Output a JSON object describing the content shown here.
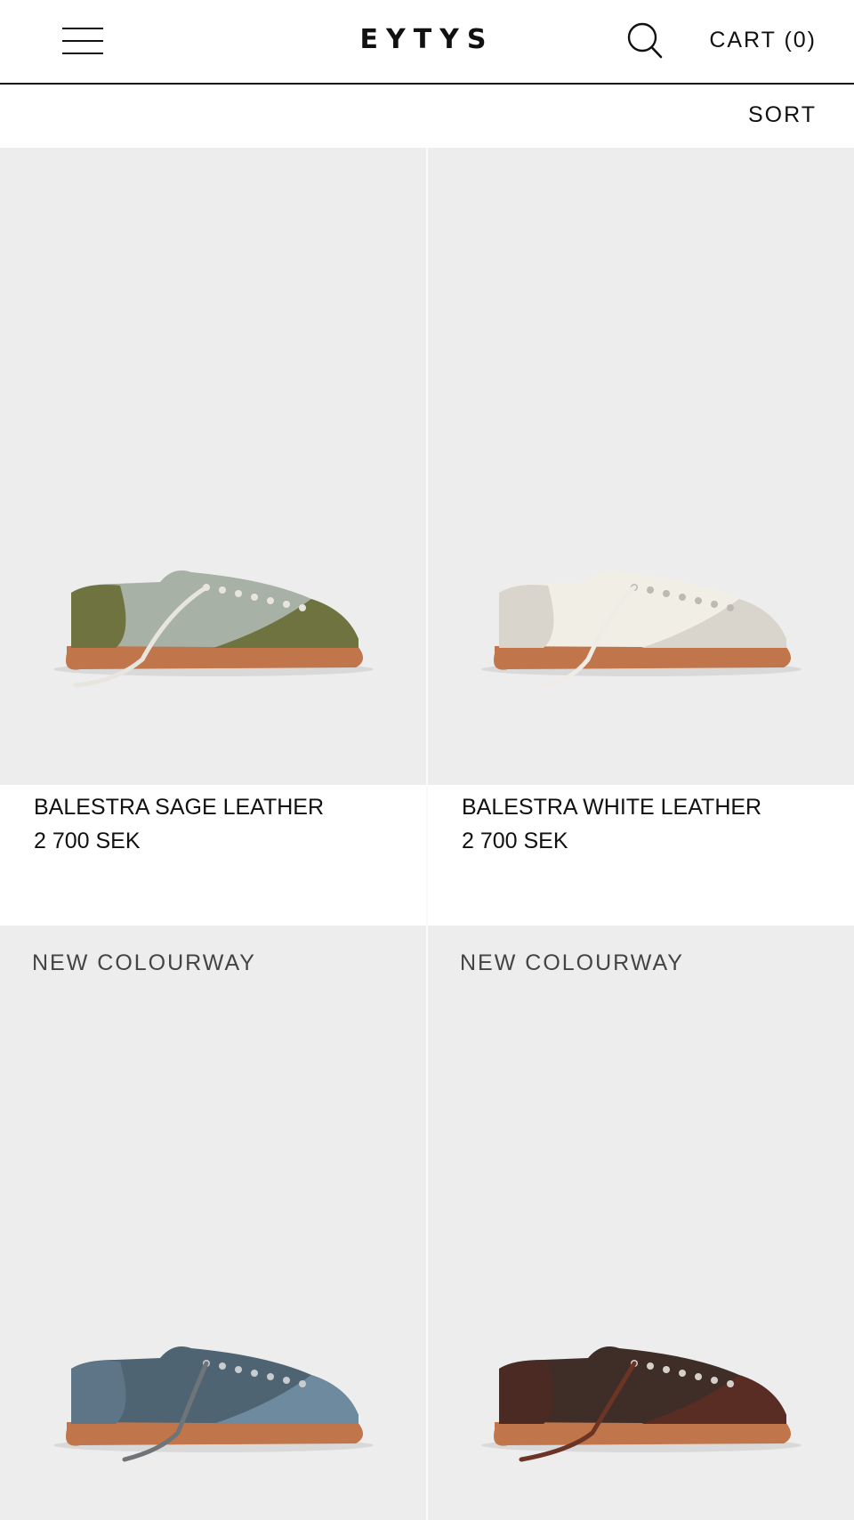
{
  "header": {
    "logo": "EYTYS",
    "cart_label": "CART",
    "cart_count": "(0)",
    "icons": {
      "menu": "hamburger-icon",
      "search": "search-icon"
    }
  },
  "toolbar": {
    "sort_label": "SORT"
  },
  "products": [
    {
      "name": "BALESTRA SAGE LEATHER",
      "price": "2 700 SEK",
      "badge": "",
      "colors": {
        "upper": "#a7b1a6",
        "suede": "#6f7340",
        "sole": "#c0764a",
        "lace": "#e8e5df"
      }
    },
    {
      "name": "BALESTRA WHITE LEATHER",
      "price": "2 700 SEK",
      "badge": "",
      "colors": {
        "upper": "#f1eee6",
        "suede": "#d9d5cd",
        "sole": "#c0764a",
        "lace": "#efece5"
      }
    },
    {
      "name": "",
      "price": "",
      "badge": "NEW COLOURWAY",
      "colors": {
        "upper": "#4f6473",
        "suede": "#6d8a9f",
        "sole": "#c0764a",
        "lace": "#6f7478"
      }
    },
    {
      "name": "",
      "price": "",
      "badge": "NEW COLOURWAY",
      "colors": {
        "upper": "#3f2e27",
        "suede": "#5a2d24",
        "sole": "#c0764a",
        "lace": "#6b3425"
      }
    }
  ],
  "theme": {
    "tile_bg": "#ededed",
    "text": "#111111"
  }
}
